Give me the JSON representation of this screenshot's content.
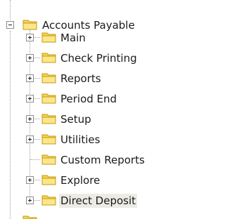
{
  "tree": {
    "root": {
      "label": "Accounts Payable",
      "expanded": true,
      "icon": "folder-icon"
    },
    "children": [
      {
        "label": "Main",
        "expandable": true
      },
      {
        "label": "Check Printing",
        "expandable": true
      },
      {
        "label": "Reports",
        "expandable": true
      },
      {
        "label": "Period End",
        "expandable": true
      },
      {
        "label": "Setup",
        "expandable": true
      },
      {
        "label": "Utilities",
        "expandable": true
      },
      {
        "label": "Custom Reports",
        "expandable": false
      },
      {
        "label": "Explore",
        "expandable": true
      },
      {
        "label": "Direct Deposit",
        "expandable": true,
        "selected": true
      }
    ],
    "colors": {
      "folder_fill": "#f6d34f",
      "folder_stroke": "#c49a14",
      "selection_bg": "#ecebe4"
    }
  }
}
